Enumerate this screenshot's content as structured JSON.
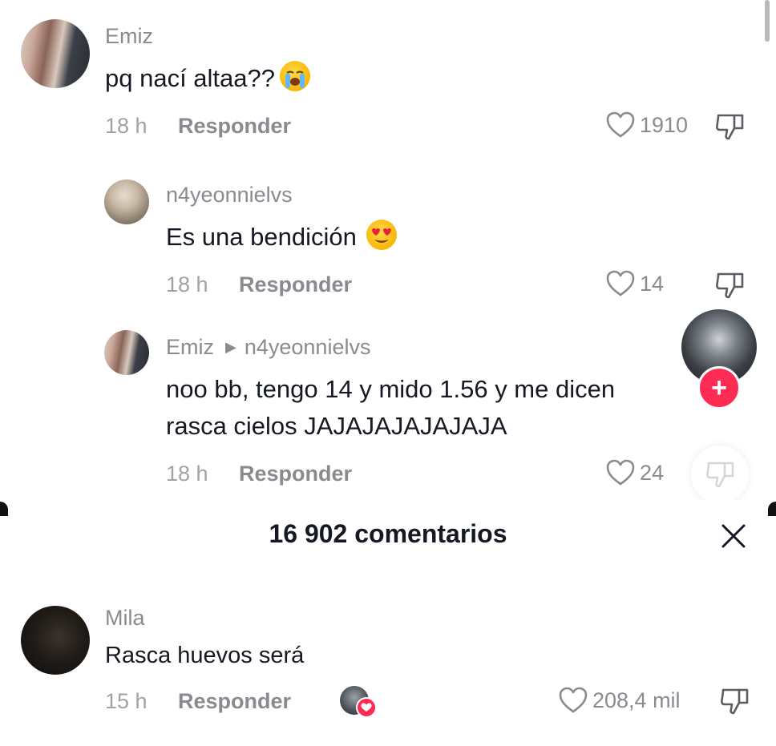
{
  "comments": [
    {
      "username": "Emiz",
      "text": "pq nací altaa??",
      "emoji": "loudly-crying-face",
      "time": "18 h",
      "reply_label": "Responder",
      "likes": "1910"
    },
    {
      "username": "n4yeonnielvs",
      "text": "Es una bendición",
      "emoji": "heart-eyes-face",
      "time": "18 h",
      "reply_label": "Responder",
      "likes": "14"
    },
    {
      "username": "Emiz",
      "reply_to": "n4yeonnielvs",
      "text_line1": "noo bb, tengo 14 y mido 1.56 y me dicen",
      "text_line2": "rasca cielos JAJAJAJAJAJAJA",
      "time": "18 h",
      "reply_label": "Responder",
      "likes": "24"
    }
  ],
  "sheet": {
    "title": "16 902 comentarios",
    "close_icon": "close-icon"
  },
  "bottom_comment": {
    "username": "Mila",
    "text": "Rasca huevos será",
    "time": "15 h",
    "reply_label": "Responder",
    "likes": "208,4 mil"
  },
  "colors": {
    "accent": "#fe2c55",
    "muted": "#8a8b91",
    "text": "#161823"
  }
}
